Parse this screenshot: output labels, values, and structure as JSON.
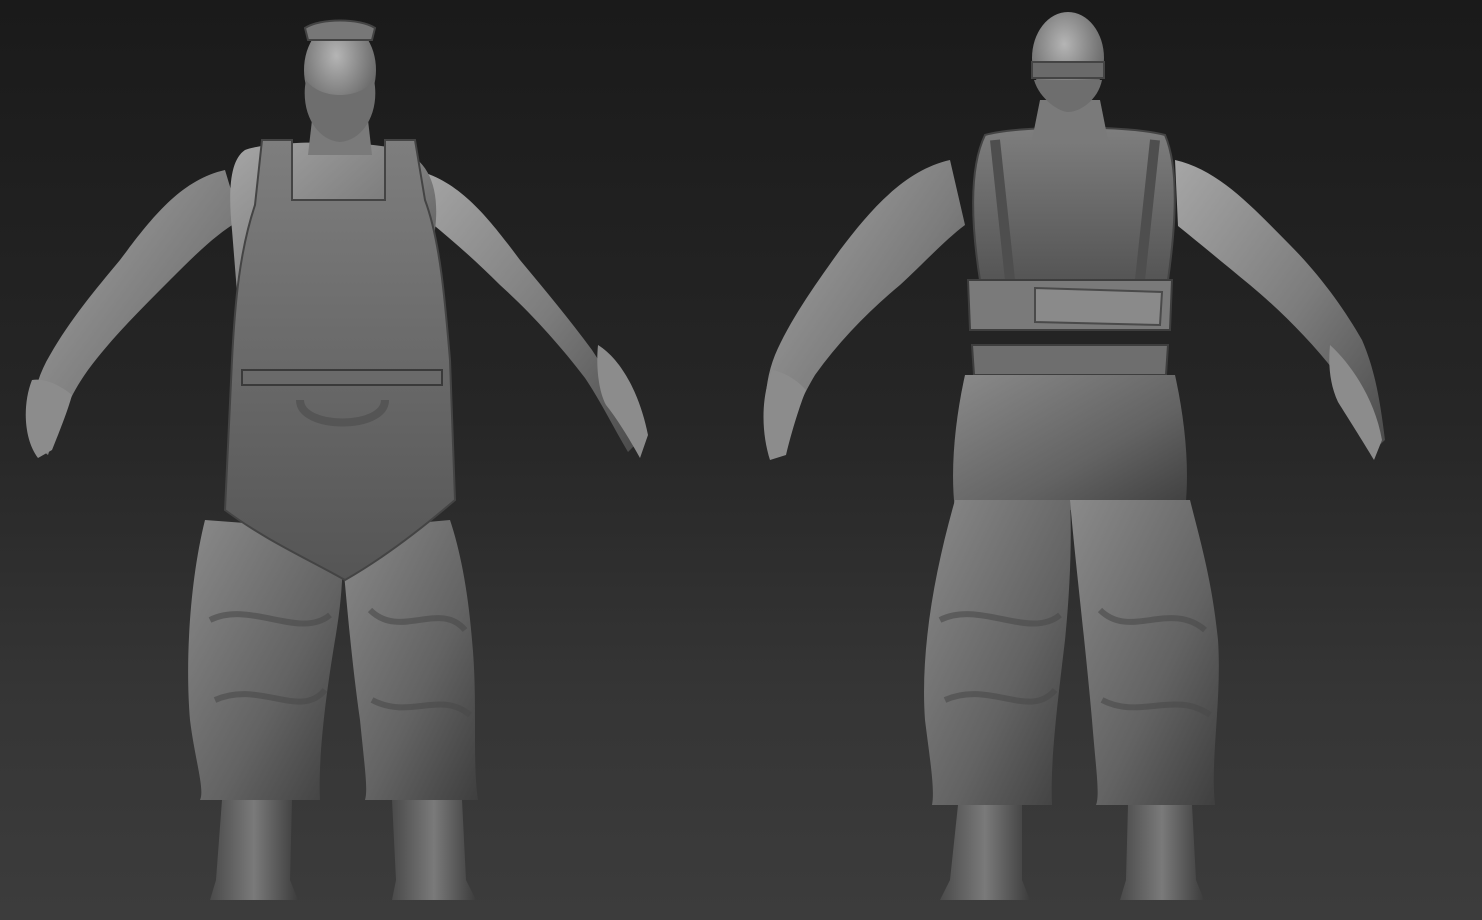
{
  "scene": {
    "background_top": "#1a1a1a",
    "background_bottom": "#3c3c3c",
    "clay_color": "#8a8a8a",
    "subject": "blacksmith-character-sculpt",
    "views": [
      "front",
      "back"
    ]
  }
}
